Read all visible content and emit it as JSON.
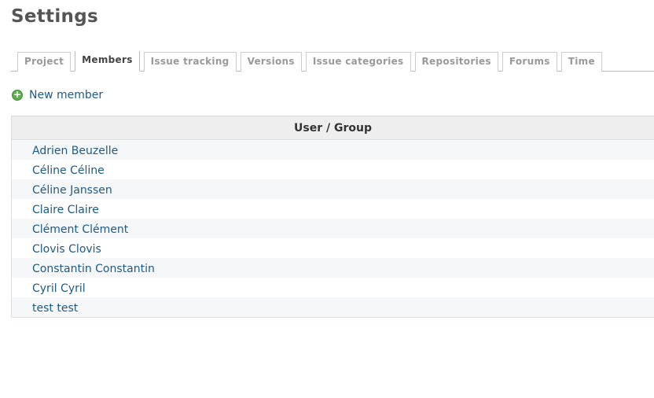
{
  "page": {
    "title": "Settings"
  },
  "tabs": [
    {
      "label": "Project",
      "selected": false
    },
    {
      "label": "Members",
      "selected": true
    },
    {
      "label": "Issue tracking",
      "selected": false
    },
    {
      "label": "Versions",
      "selected": false
    },
    {
      "label": "Issue categories",
      "selected": false
    },
    {
      "label": "Repositories",
      "selected": false
    },
    {
      "label": "Forums",
      "selected": false
    },
    {
      "label": "Time",
      "selected": false
    }
  ],
  "actions": {
    "new_member_label": "New member",
    "new_member_icon": "add-circle-icon"
  },
  "members_table": {
    "header": "User / Group",
    "rows": [
      "Adrien Beuzelle",
      "Céline Céline",
      "Céline Janssen",
      "Claire Claire",
      "Clément Clément",
      "Clovis Clovis",
      "Constantin Constantin",
      "Cyril Cyril",
      "test test"
    ]
  },
  "colors": {
    "link": "#1d5a85",
    "add_icon": "#5fae4f",
    "header_bg": "#eeeeee",
    "odd_row_bg": "#f6f7f8"
  }
}
